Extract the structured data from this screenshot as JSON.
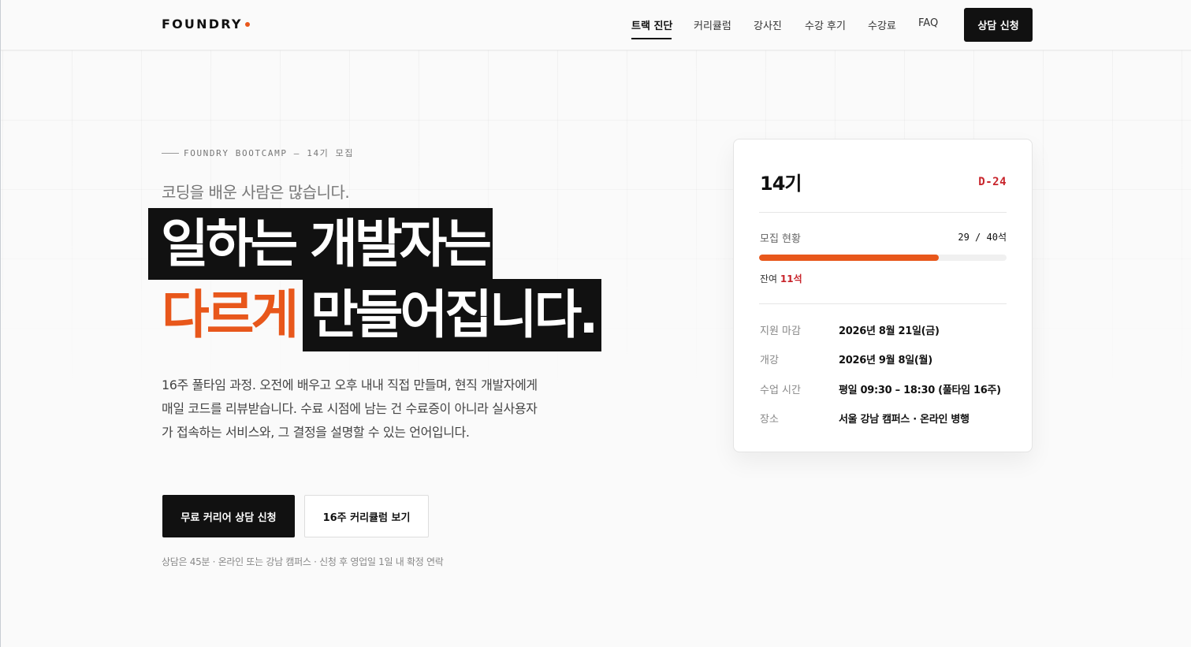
{
  "header": {
    "logo": "FOUNDRY",
    "nav": [
      {
        "label": "트랙 진단",
        "active": true
      },
      {
        "label": "커리큘럼",
        "active": false
      },
      {
        "label": "강사진",
        "active": false
      },
      {
        "label": "수강 후기",
        "active": false
      },
      {
        "label": "수강료",
        "active": false
      },
      {
        "label": "FAQ",
        "active": false
      }
    ],
    "cta": "상담 신청"
  },
  "hero": {
    "eyebrow": "FOUNDRY BOOTCAMP — 14기 모집",
    "lead": "코딩을 배운 사람은 많습니다.",
    "headline_line1": "일하는 개발자는",
    "headline_line2_accent": "다르게",
    "headline_line2_rest": "만들어집니다.",
    "description": "16주 풀타임 과정. 오전에 배우고 오후 내내 직접 만들며, 현직 개발자에게 매일 코드를 리뷰받습니다. 수료 시점에 남는 건 수료증이 아니라 실사용자가 접속하는 서비스와, 그 결정을 설명할 수 있는 언어입니다.",
    "primary_button": "무료 커리어 상담 신청",
    "secondary_button": "16주 커리큘럼 보기",
    "note": "상담은 45분 · 온라인 또는 강남 캠퍼스 · 신청 후 영업일 1일 내 확정 연락"
  },
  "card": {
    "title": "14기",
    "dday": "D-24",
    "recruit_label": "모집 현황",
    "recruit_count": "29 / 40석",
    "recruit_progress": 0.725,
    "remain_label": "잔여",
    "remain_value": "11석",
    "info": [
      {
        "key": "지원 마감",
        "value": "2026년 8월 21일(금)"
      },
      {
        "key": "개강",
        "value": "2026년 9월 8일(월)"
      },
      {
        "key": "수업 시간",
        "value": "평일 09:30 – 18:30 (풀타임 16주)"
      },
      {
        "key": "장소",
        "value": "서울 강남 캠퍼스 · 온라인 병행"
      }
    ]
  },
  "colors": {
    "accent": "#e8571b",
    "dark": "#111111",
    "dday": "#c8242b"
  }
}
